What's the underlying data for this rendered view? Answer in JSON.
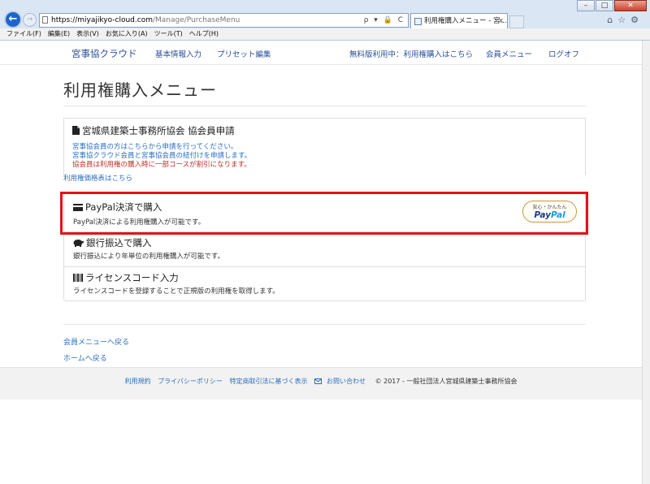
{
  "browser": {
    "address": {
      "host": "https://miyajikyo-cloud.com",
      "path": "/Manage/PurchaseMenu",
      "icons": "ρ ▾ 🔒 C"
    },
    "tab_title": "利用権購入メニュー - 宮...",
    "tab_close": "×",
    "menu": [
      "ファイル(F)",
      "編集(E)",
      "表示(V)",
      "お気に入り(A)",
      "ツール(T)",
      "ヘルプ(H)"
    ],
    "window_buttons": {
      "minimize": "–",
      "maximize": "□",
      "close": "✕"
    }
  },
  "nav": {
    "brand": "宮事協クラウド",
    "links": [
      "基本情報入力",
      "プリセット編集"
    ],
    "trial_notice": "無料版利用中：利用権購入はこちら",
    "member_menu": "会員メニュー",
    "logout": "ログオフ"
  },
  "page_title": "利用権購入メニュー",
  "association": {
    "title": "宮城県建築士事務所協会 協会員申請",
    "lines": [
      "宮事協会員の方はこちらから申請を行ってください。",
      "宮事協クラウド会員と宮事協会員の紐付けを申請します。",
      "協会員は利用権の購入時に一部コースが割引になります。"
    ]
  },
  "price_link": "利用権価格表はこちら",
  "methods": [
    {
      "title": "PayPal決済で購入",
      "desc": "PayPal決済による利用権購入が可能です。",
      "icon": "credit-card-icon"
    },
    {
      "title": "銀行振込で購入",
      "desc": "銀行振込により年単位の利用権購入が可能です。",
      "icon": "piggy-bank-icon"
    },
    {
      "title": "ライセンスコード入力",
      "desc": "ライセンスコードを登録することで正規版の利用権を取得します。",
      "icon": "barcode-icon"
    }
  ],
  "paypal_badge": {
    "small": "安心・かんたん",
    "logo_a": "Pay",
    "logo_b": "Pal"
  },
  "back_links": {
    "member_menu": "会員メニューへ戻る",
    "home": "ホームへ戻る"
  },
  "footer": {
    "terms": "利用規約",
    "privacy": "プライバシーポリシー",
    "commerce": "特定商取引法に基づく表示",
    "contact": "お問い合わせ",
    "copyright": "© 2017 - 一般社団法人宮城県建築士事務所協会"
  },
  "colors": {
    "link": "#2a6fc0",
    "highlight": "#e0141b",
    "notice": "#c0302a"
  }
}
